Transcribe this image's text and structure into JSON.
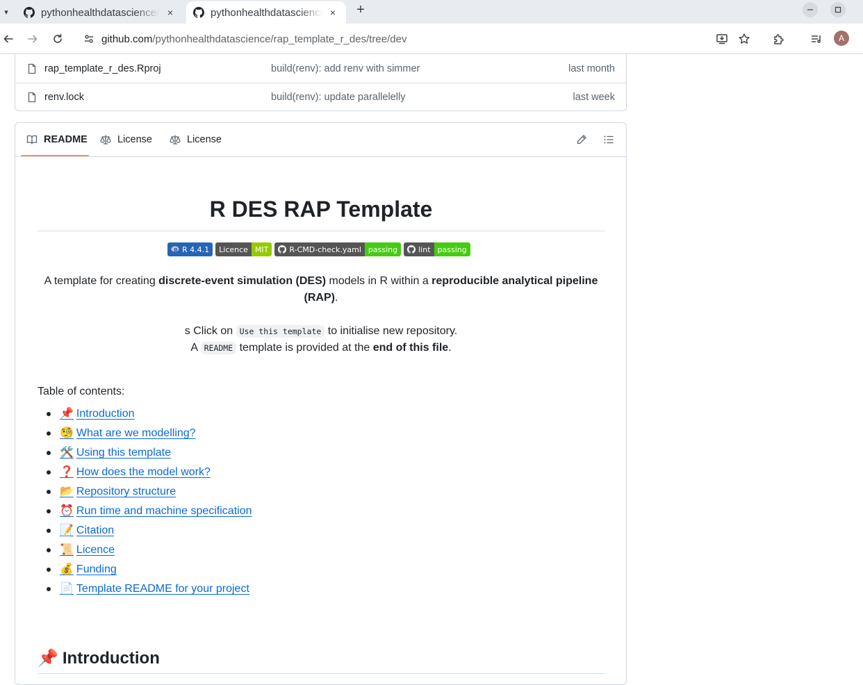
{
  "browser": {
    "tabs": [
      {
        "title": "pythonhealthdatascience/rap_template_r_des",
        "active": false
      },
      {
        "title": "pythonhealthdatascience/rap_template_r_des",
        "active": true
      }
    ],
    "close_glyph": "×",
    "new_tab_glyph": "+",
    "url_host": "github.com",
    "url_path": "/pythonhealthdatascience/rap_template_r_des/tree/dev",
    "profile_initial": "A"
  },
  "files": [
    {
      "name": "rap_template_r_des.Rproj",
      "commit": "build(renv): add renv with simmer",
      "date": "last month"
    },
    {
      "name": "renv.lock",
      "commit": "build(renv): update parallelelly",
      "date": "last week"
    }
  ],
  "readme_tabs": [
    {
      "label": "README",
      "icon": "book-icon"
    },
    {
      "label": "License",
      "icon": "law-icon"
    },
    {
      "label": "License",
      "icon": "law-icon"
    }
  ],
  "readme": {
    "title": "R DES RAP Template",
    "badges": [
      {
        "left": "R 4.4.1",
        "right": "",
        "left_color": "#2466b5",
        "right_color": "",
        "icon": "r-logo-icon"
      },
      {
        "left": "Licence",
        "right": "MIT",
        "left_color": "#555555",
        "right_color": "#97ca00",
        "icon": ""
      },
      {
        "left": "R-CMD-check.yaml",
        "right": "passing",
        "left_color": "#555555",
        "right_color": "#4c1",
        "icon": "github-icon"
      },
      {
        "left": "lint",
        "right": "passing",
        "left_color": "#555555",
        "right_color": "#4c1",
        "icon": "github-icon"
      }
    ],
    "intro": {
      "t1": "A template for creating ",
      "b1": "discrete-event simulation (DES)",
      "t2": " models in R within a ",
      "b2": "reproducible analytical pipeline (RAP)",
      "t3": "."
    },
    "use": {
      "l1_pre": "s Click on ",
      "l1_code": "Use this template",
      "l1_post": " to initialise new repository.",
      "l2_pre": "A ",
      "l2_code": "README",
      "l2_mid": " template is provided at the ",
      "l2_bold": "end of this file",
      "l2_post": "."
    },
    "toc_label": "Table of contents:",
    "toc": [
      {
        "emoji": "📌",
        "text": "Introduction"
      },
      {
        "emoji": "🧐",
        "text": "What are we modelling?"
      },
      {
        "emoji": "🛠️",
        "text": "Using this template"
      },
      {
        "emoji": "❓",
        "text": "How does the model work?"
      },
      {
        "emoji": "📂",
        "text": "Repository structure"
      },
      {
        "emoji": "⏰",
        "text": "Run time and machine specification"
      },
      {
        "emoji": "📝",
        "text": "Citation"
      },
      {
        "emoji": "📜",
        "text": "Licence"
      },
      {
        "emoji": "💰",
        "text": "Funding"
      },
      {
        "emoji": "📄",
        "text": "Template README for your project"
      }
    ],
    "section_emoji": "📌",
    "section_title": "Introduction"
  },
  "colors": {
    "link": "#0969da",
    "tab_underline": "#fd8c73",
    "border": "#d0d7de"
  }
}
